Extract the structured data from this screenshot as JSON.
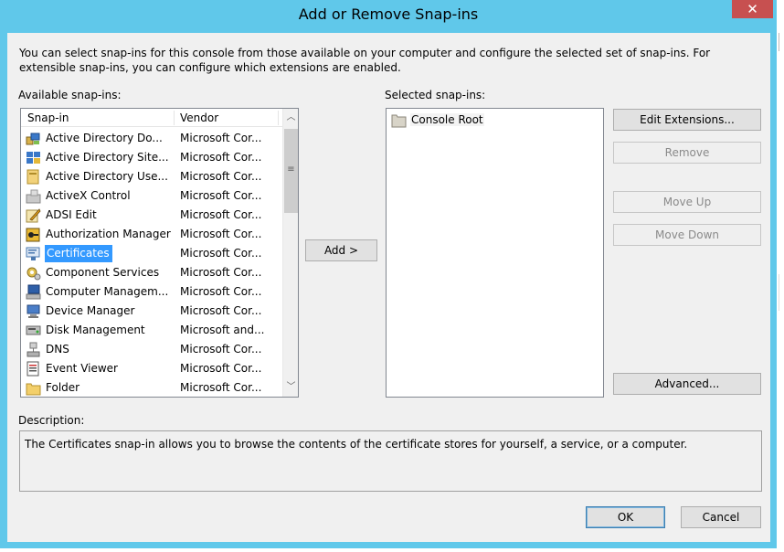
{
  "window": {
    "title": "Add or Remove Snap-ins",
    "close_glyph": "✕"
  },
  "intro_text": "You can select snap-ins for this console from those available on your computer and configure the selected set of snap-ins. For extensible snap-ins, you can configure which extensions are enabled.",
  "available": {
    "label": "Available snap-ins:",
    "columns": {
      "snapin": "Snap-in",
      "vendor": "Vendor"
    },
    "items": [
      {
        "name": "Active Directory Do...",
        "vendor": "Microsoft Cor...",
        "icon": "active-directory-domains-icon",
        "selected": false
      },
      {
        "name": "Active Directory Site...",
        "vendor": "Microsoft Cor...",
        "icon": "active-directory-sites-icon",
        "selected": false
      },
      {
        "name": "Active Directory Use...",
        "vendor": "Microsoft Cor...",
        "icon": "active-directory-users-icon",
        "selected": false
      },
      {
        "name": "ActiveX Control",
        "vendor": "Microsoft Cor...",
        "icon": "activex-control-icon",
        "selected": false
      },
      {
        "name": "ADSI Edit",
        "vendor": "Microsoft Cor...",
        "icon": "adsi-edit-icon",
        "selected": false
      },
      {
        "name": "Authorization Manager",
        "vendor": "Microsoft Cor...",
        "icon": "authorization-manager-icon",
        "selected": false
      },
      {
        "name": "Certificates",
        "vendor": "Microsoft Cor...",
        "icon": "certificates-icon",
        "selected": true
      },
      {
        "name": "Component Services",
        "vendor": "Microsoft Cor...",
        "icon": "component-services-icon",
        "selected": false
      },
      {
        "name": "Computer Managem...",
        "vendor": "Microsoft Cor...",
        "icon": "computer-management-icon",
        "selected": false
      },
      {
        "name": "Device Manager",
        "vendor": "Microsoft Cor...",
        "icon": "device-manager-icon",
        "selected": false
      },
      {
        "name": "Disk Management",
        "vendor": "Microsoft and...",
        "icon": "disk-management-icon",
        "selected": false
      },
      {
        "name": "DNS",
        "vendor": "Microsoft Cor...",
        "icon": "dns-icon",
        "selected": false
      },
      {
        "name": "Event Viewer",
        "vendor": "Microsoft Cor...",
        "icon": "event-viewer-icon",
        "selected": false
      },
      {
        "name": "Folder",
        "vendor": "Microsoft Cor...",
        "icon": "folder-icon",
        "selected": false
      }
    ],
    "scroll_up_glyph": "︿",
    "scroll_down_glyph": "﹀",
    "grip_glyph": "≡"
  },
  "add_button": "Add >",
  "selected": {
    "label": "Selected snap-ins:",
    "items": [
      {
        "name": "Console Root",
        "icon": "console-root-folder-icon"
      }
    ]
  },
  "buttons": {
    "edit_extensions": "Edit Extensions...",
    "remove": "Remove",
    "move_up": "Move Up",
    "move_down": "Move Down",
    "advanced": "Advanced...",
    "ok": "OK",
    "cancel": "Cancel"
  },
  "description": {
    "label": "Description:",
    "text": "The Certificates snap-in allows you to browse the contents of the certificate stores for yourself, a service, or a computer."
  },
  "colors": {
    "title_bar": "#60c8ea",
    "close_button": "#c75050",
    "selection": "#3399ff",
    "dialog_bg": "#f0f0f0"
  }
}
